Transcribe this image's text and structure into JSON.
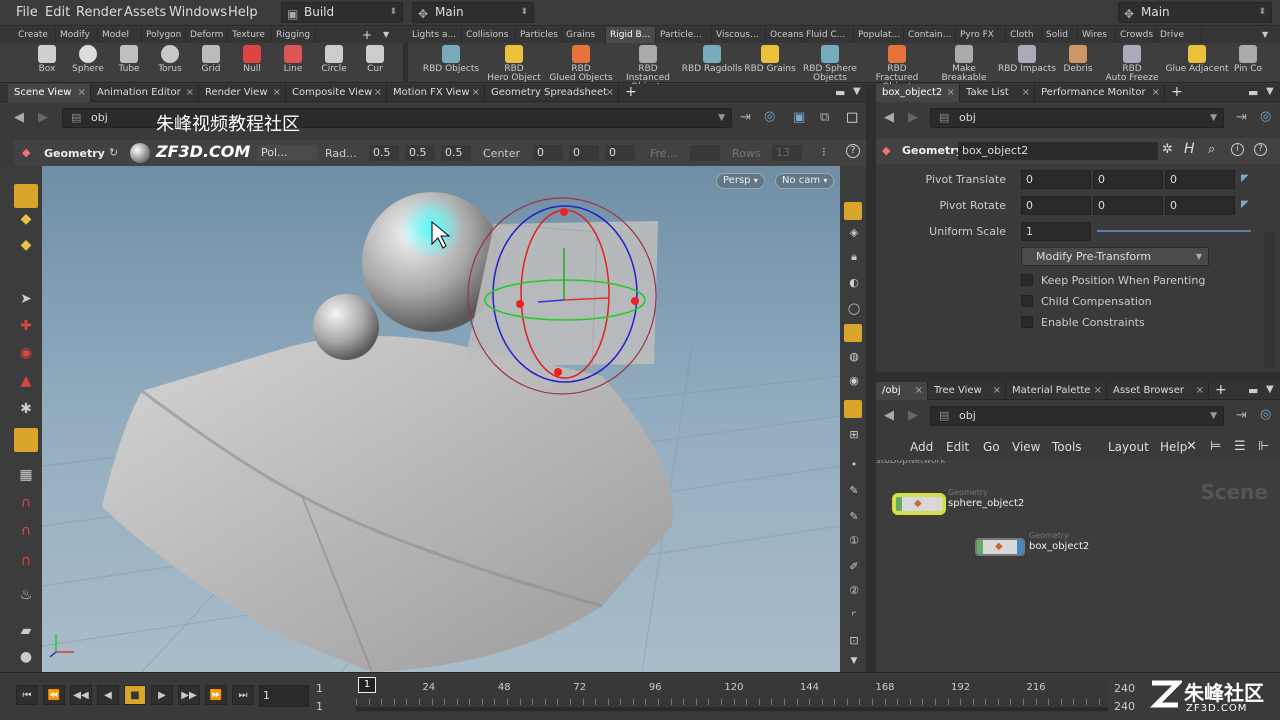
{
  "menubar": {
    "items": [
      "File",
      "Edit",
      "Render",
      "Assets",
      "Windows",
      "Help"
    ],
    "desktop": "Build",
    "context": "Main",
    "right_desktop": "Main"
  },
  "shelf": {
    "tabs_left": [
      "Create",
      "Modify",
      "Model",
      "Polygon",
      "Deform",
      "Texture",
      "Rigging"
    ],
    "tabs_right": [
      "Lights a...",
      "Collisions",
      "Particles",
      "Grains",
      "Rigid B...",
      "Particle...",
      "Viscous...",
      "Oceans",
      "Fluid C...",
      "Populat...",
      "Contain...",
      "Pyro FX",
      "Cloth",
      "Solid",
      "Wires",
      "Crowds",
      "Drive Si..."
    ],
    "tools_left": [
      "Box",
      "Sphere",
      "Tube",
      "Torus",
      "Grid",
      "Null",
      "Line",
      "Circle",
      "Cur"
    ],
    "tools_right": [
      [
        "RBD Objects"
      ],
      [
        "RBD",
        "Hero Object"
      ],
      [
        "RBD",
        "Glued Objects"
      ],
      [
        "RBD Instanced",
        "Objects"
      ],
      [
        "RBD Ragdolls"
      ],
      [
        "RBD Grains"
      ],
      [
        "RBD Sphere",
        "Objects"
      ],
      [
        "RBD Fractured",
        "Object"
      ],
      [
        "Make",
        "Breakable"
      ],
      [
        "RBD Impacts"
      ],
      [
        "Debris"
      ],
      [
        "RBD",
        "Auto Freeze"
      ],
      [
        "Glue Adjacent"
      ],
      [
        "Pin Co"
      ]
    ]
  },
  "left_panel": {
    "tabs": [
      "Scene View",
      "Animation Editor",
      "Render View",
      "Composite View",
      "Motion FX View",
      "Geometry Spreadsheet"
    ],
    "path": "obj",
    "watermark": "朱峰视频教程社区",
    "watermark2": "ZF3D.COM",
    "op": "Geometry",
    "primitive": "Pol...",
    "radius_label": "Rad...",
    "radius": [
      "0.5",
      "0.5",
      "0.5"
    ],
    "center_label": "Center",
    "center": [
      "0",
      "0",
      "0"
    ],
    "freq_label": "Fre...",
    "rows_label": "Rows",
    "rows": "13",
    "persp": "Persp",
    "cam": "No cam"
  },
  "params": {
    "tabs": [
      "box_object2",
      "Take List",
      "Performance Monitor"
    ],
    "path": "obj",
    "op_type": "Geometry",
    "node_name": "box_object2",
    "pivot_translate_label": "Pivot Translate",
    "pivot_translate": [
      "0",
      "0",
      "0"
    ],
    "pivot_rotate_label": "Pivot Rotate",
    "pivot_rotate": [
      "0",
      "0",
      "0"
    ],
    "uniform_scale_label": "Uniform Scale",
    "uniform_scale": "1",
    "modify_button": "Modify Pre-Transform",
    "checks": [
      "Keep Position When Parenting",
      "Child Compensation",
      "Enable Constraints"
    ]
  },
  "network": {
    "tabs": [
      "/obj",
      "Tree View",
      "Material Palette",
      "Asset Browser"
    ],
    "path": "obj",
    "menu": [
      "Add",
      "Edit",
      "Go",
      "View",
      "Tools",
      "Layout",
      "Help"
    ],
    "corner": "Scene",
    "crumb": "stoDopNetwork",
    "nodes": [
      {
        "type": "Geometry",
        "name": "sphere_object2"
      },
      {
        "type": "Geometry",
        "name": "box_object2"
      }
    ]
  },
  "timeline": {
    "frame": "1",
    "start": "1",
    "start2": "1",
    "ticks": [
      "1",
      "24",
      "48",
      "72",
      "96",
      "120",
      "144",
      "168",
      "192",
      "216",
      "240"
    ],
    "end": "240",
    "end2": "240",
    "logo_cn": "朱峰社区",
    "logo_url": "ZF3D.COM"
  }
}
